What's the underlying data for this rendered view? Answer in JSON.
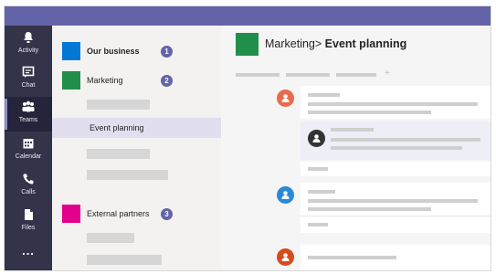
{
  "colors": {
    "topbar": "#6264a7",
    "rail": "#33344a",
    "badge": "#6264a7",
    "our_business": "#0078d4",
    "marketing": "#1f8f4a",
    "external_partners": "#e3008c"
  },
  "rail": {
    "items": [
      {
        "label": "Activity",
        "icon": "bell-icon"
      },
      {
        "label": "Chat",
        "icon": "chat-icon"
      },
      {
        "label": "Teams",
        "icon": "teams-icon",
        "active": true
      },
      {
        "label": "Calendar",
        "icon": "calendar-icon"
      },
      {
        "label": "Calls",
        "icon": "phone-icon"
      },
      {
        "label": "Files",
        "icon": "file-icon"
      }
    ],
    "more": "..."
  },
  "teams": {
    "items": [
      {
        "name": "Our business",
        "badge": "1"
      },
      {
        "name": "Marketing",
        "badge": "2"
      },
      {
        "name": "External partners",
        "badge": "3"
      }
    ],
    "active_channel": "Event planning"
  },
  "main": {
    "title_team": "Marketing>",
    "title_channel": "Event planning",
    "tab_add": "+"
  },
  "messages": {
    "avatar_colors": [
      "#ea6a4d",
      "#333333",
      "#2b88d8",
      "#d84a1b"
    ]
  }
}
